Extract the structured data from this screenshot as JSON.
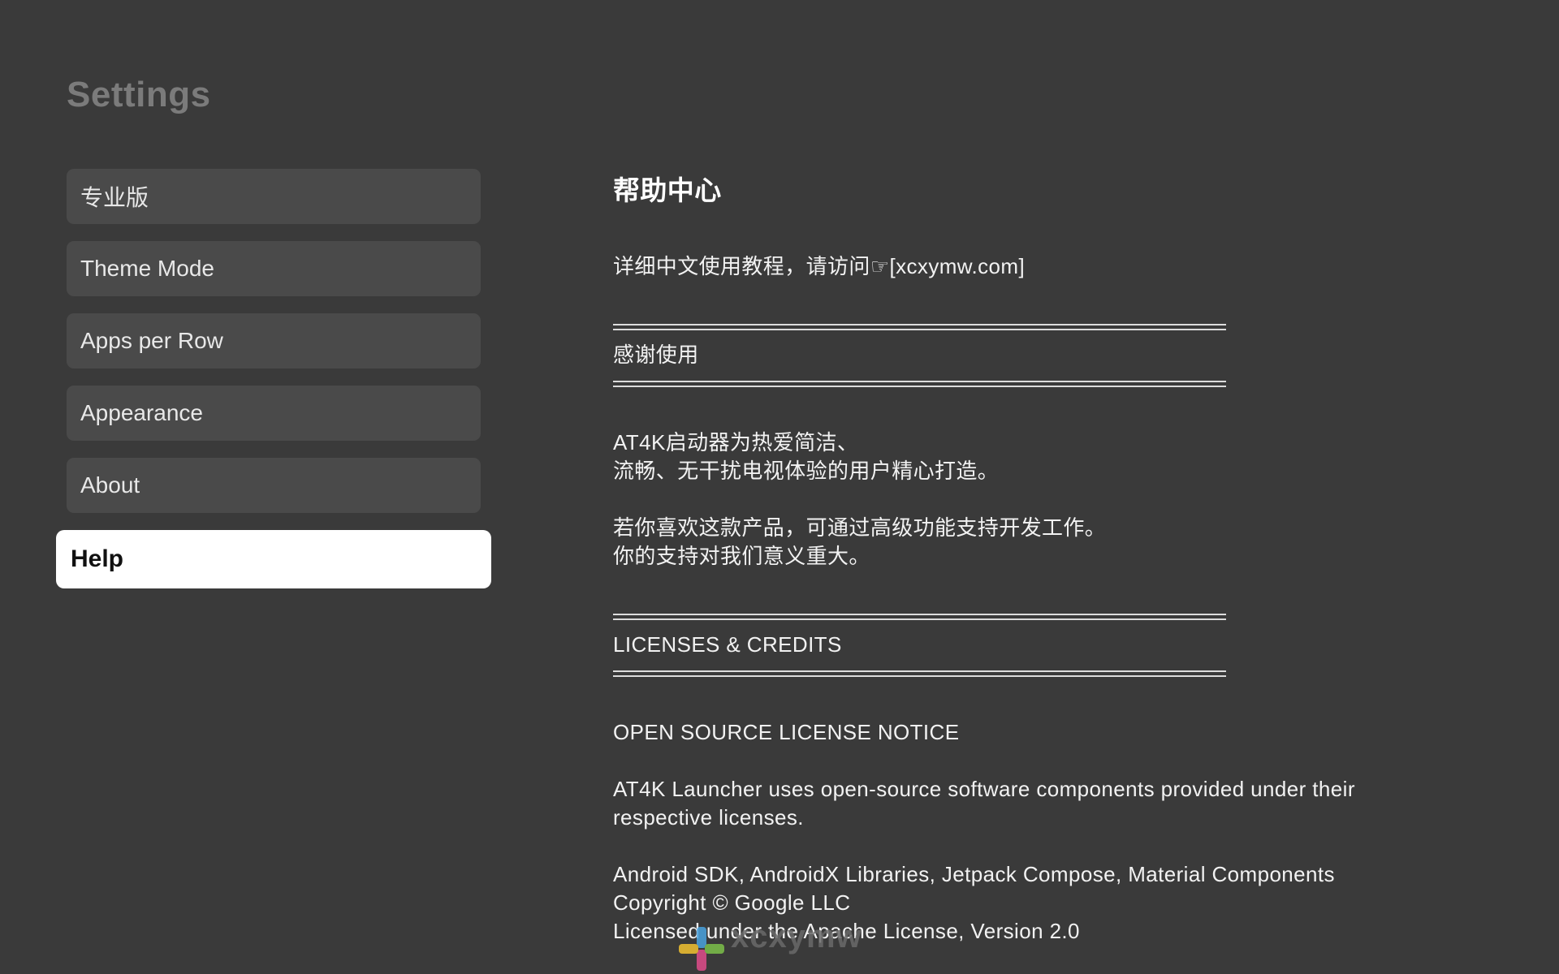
{
  "page": {
    "title": "Settings"
  },
  "menu": {
    "items": [
      {
        "label": "专业版"
      },
      {
        "label": "Theme Mode"
      },
      {
        "label": "Apps per Row"
      },
      {
        "label": "Appearance"
      },
      {
        "label": "About"
      },
      {
        "label": "Help",
        "selected": true
      }
    ]
  },
  "help": {
    "heading": "帮助中心",
    "tutorial_line": "详细中文使用教程，请访问☞[xcxymw.com]",
    "thanks_title": "感谢使用",
    "thanks_line1": "AT4K启动器为热爱简洁、",
    "thanks_line2": "流畅、无干扰电视体验的用户精心打造。",
    "support_line1": "若你喜欢这款产品，可通过高级功能支持开发工作。",
    "support_line2": "你的支持对我们意义重大。",
    "licenses_title": "LICENSES & CREDITS",
    "notice_title": "OPEN SOURCE LICENSE NOTICE",
    "notice_line1": "AT4K Launcher uses open-source software components provided under their",
    "notice_line2": "respective licenses.",
    "component_line1": "Android SDK, AndroidX Libraries, Jetpack Compose, Material Components",
    "component_line2": "Copyright © Google LLC",
    "component_line3": "Licensed under the Apache License, Version 2.0"
  },
  "watermark": {
    "text": "xcxymw"
  },
  "colors": {
    "background": "#3a3a3a",
    "menu_item": "#4a4a4a",
    "menu_selected": "#ffffff",
    "title": "#7b7b7b"
  }
}
